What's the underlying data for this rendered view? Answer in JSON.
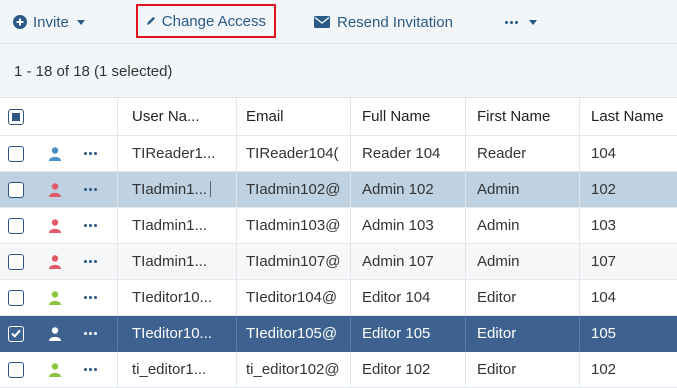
{
  "toolbar": {
    "invite_label": "Invite",
    "change_access_label": "Change Access",
    "resend_label": "Resend Invitation",
    "more_label": "…"
  },
  "status": {
    "count_text": "1 - 18 of 18 (1 selected)"
  },
  "columns": [
    "User Na...",
    "Email",
    "Full Name",
    "First Name",
    "Last Name"
  ],
  "rows": [
    {
      "username": "TIReader1...",
      "email": "TIReader104(",
      "full_name": "Reader 104",
      "first_name": "Reader",
      "last_name": "104",
      "role_color": "#4a90c8",
      "checked": false,
      "state": "normal"
    },
    {
      "username": "TIadmin1...",
      "email": "TIadmin102@",
      "full_name": "Admin 102",
      "first_name": "Admin",
      "last_name": "102",
      "role_color": "#e05a68",
      "checked": false,
      "state": "hover"
    },
    {
      "username": "TIadmin1...",
      "email": "TIadmin103@",
      "full_name": "Admin 103",
      "first_name": "Admin",
      "last_name": "103",
      "role_color": "#e05a68",
      "checked": false,
      "state": "normal"
    },
    {
      "username": "TIadmin1...",
      "email": "TIadmin107@",
      "full_name": "Admin 107",
      "first_name": "Admin",
      "last_name": "107",
      "role_color": "#e05a68",
      "checked": false,
      "state": "alt"
    },
    {
      "username": "TIeditor10...",
      "email": "TIeditor104@",
      "full_name": "Editor 104",
      "first_name": "Editor",
      "last_name": "104",
      "role_color": "#8cc63f",
      "checked": false,
      "state": "normal"
    },
    {
      "username": "TIeditor10...",
      "email": "TIeditor105@",
      "full_name": "Editor 105",
      "first_name": "Editor",
      "last_name": "105",
      "role_color": "#ffffff",
      "checked": true,
      "state": "selected"
    },
    {
      "username": "ti_editor1...",
      "email": "ti_editor102@",
      "full_name": "Editor 102",
      "first_name": "Editor",
      "last_name": "102",
      "role_color": "#8cc63f",
      "checked": false,
      "state": "normal"
    }
  ],
  "colors": {
    "accent": "#2a5a86",
    "selected_row": "#3e628f",
    "hover_row": "#bfd2e1",
    "highlight_border": "#e0141e"
  },
  "icons": {
    "invite": "plus-circle-icon",
    "change_access": "pencil-icon",
    "resend": "envelope-icon",
    "row_user": "user-icon",
    "row_menu": "ellipsis-icon"
  }
}
